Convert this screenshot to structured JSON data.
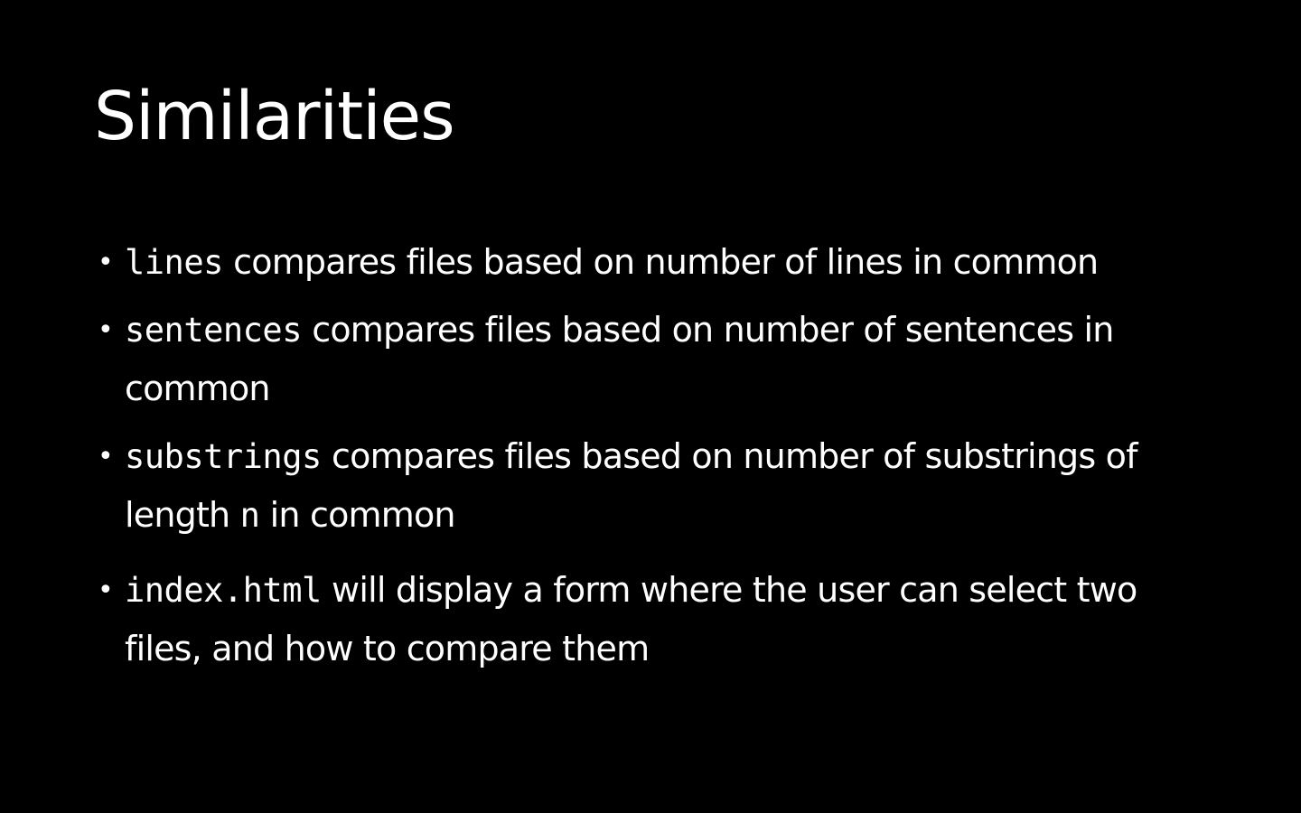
{
  "slide": {
    "title": "Similarities",
    "bullets": [
      {
        "code": "lines",
        "text": " compares files based on number of lines in common"
      },
      {
        "code": "sentences",
        "text": " compares files based on number of sentences in common"
      },
      {
        "code": "substrings",
        "text": " compares files based on number of substrings of length ",
        "code2": "n",
        "text2": " in common"
      },
      {
        "code": "index.html",
        "text": " will display a form where the user can select two files, and how to compare them"
      }
    ],
    "bullet_glyph": "•"
  }
}
